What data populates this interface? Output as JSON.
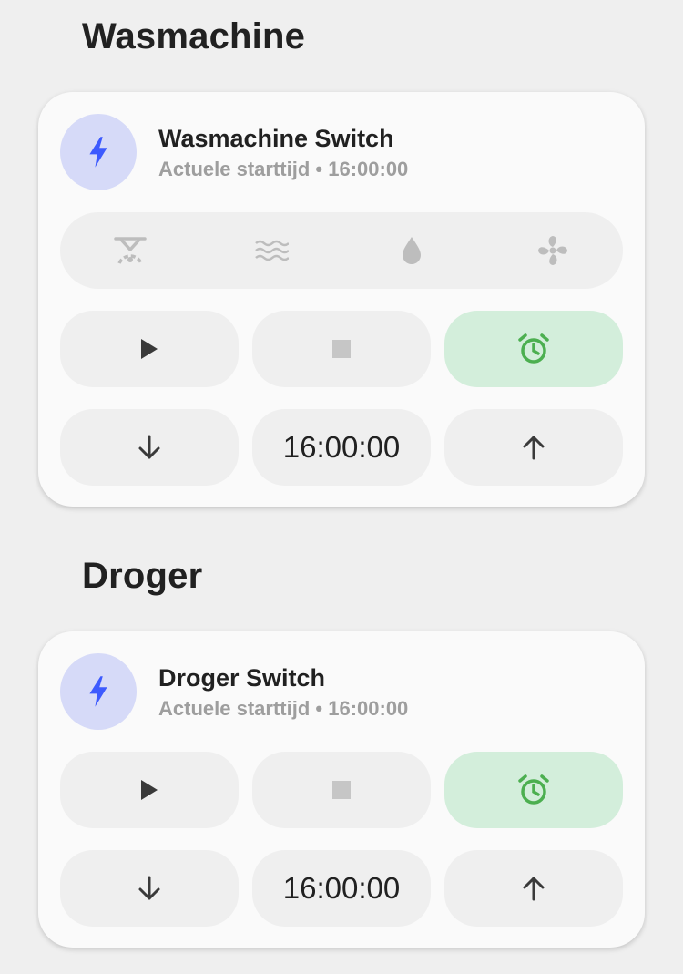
{
  "sections": [
    {
      "title": "Wasmachine",
      "entity_name": "Wasmachine Switch",
      "state_label": "Actuele starttijd",
      "state_sep": "•",
      "state_value": "16:00:00",
      "icon": "lightning-bolt-icon",
      "modes": [
        "spin-cycle-icon",
        "waves-icon",
        "water-drop-icon",
        "fan-icon"
      ],
      "time_value": "16:00:00"
    },
    {
      "title": "Droger",
      "entity_name": "Droger Switch",
      "state_label": "Actuele starttijd",
      "state_sep": "•",
      "state_value": "16:00:00",
      "icon": "lightning-bolt-icon",
      "time_value": "16:00:00"
    }
  ],
  "colors": {
    "icon_bg": "#d6daf8",
    "icon_fg": "#3d5afe",
    "alarm_bg": "#d3eedb",
    "alarm_fg": "#4caf50",
    "muted_icon": "#bdbdbd"
  }
}
